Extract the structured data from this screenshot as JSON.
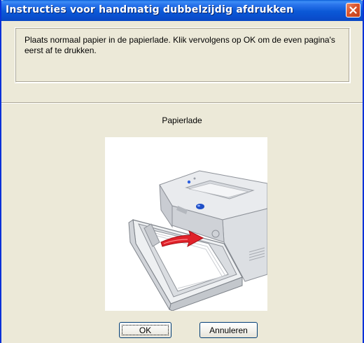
{
  "window": {
    "title": "Instructies voor handmatig dubbelzijdig afdrukken",
    "close_icon": "close-icon"
  },
  "message": {
    "text": "Plaats normaal papier in de papierlade.  Klik vervolgens op OK om de even pagina's eerst af te drukken."
  },
  "illustration": {
    "caption": "Papierlade",
    "icon": "printer-paper-tray-illustration"
  },
  "buttons": {
    "ok_label": "OK",
    "cancel_label": "Annuleren"
  },
  "colors": {
    "titlebar_blue": "#0a58d6",
    "window_face": "#ece9d8",
    "close_red": "#d9532b",
    "arrow_red": "#e0222a",
    "button_blue": "#1f4fc7"
  }
}
